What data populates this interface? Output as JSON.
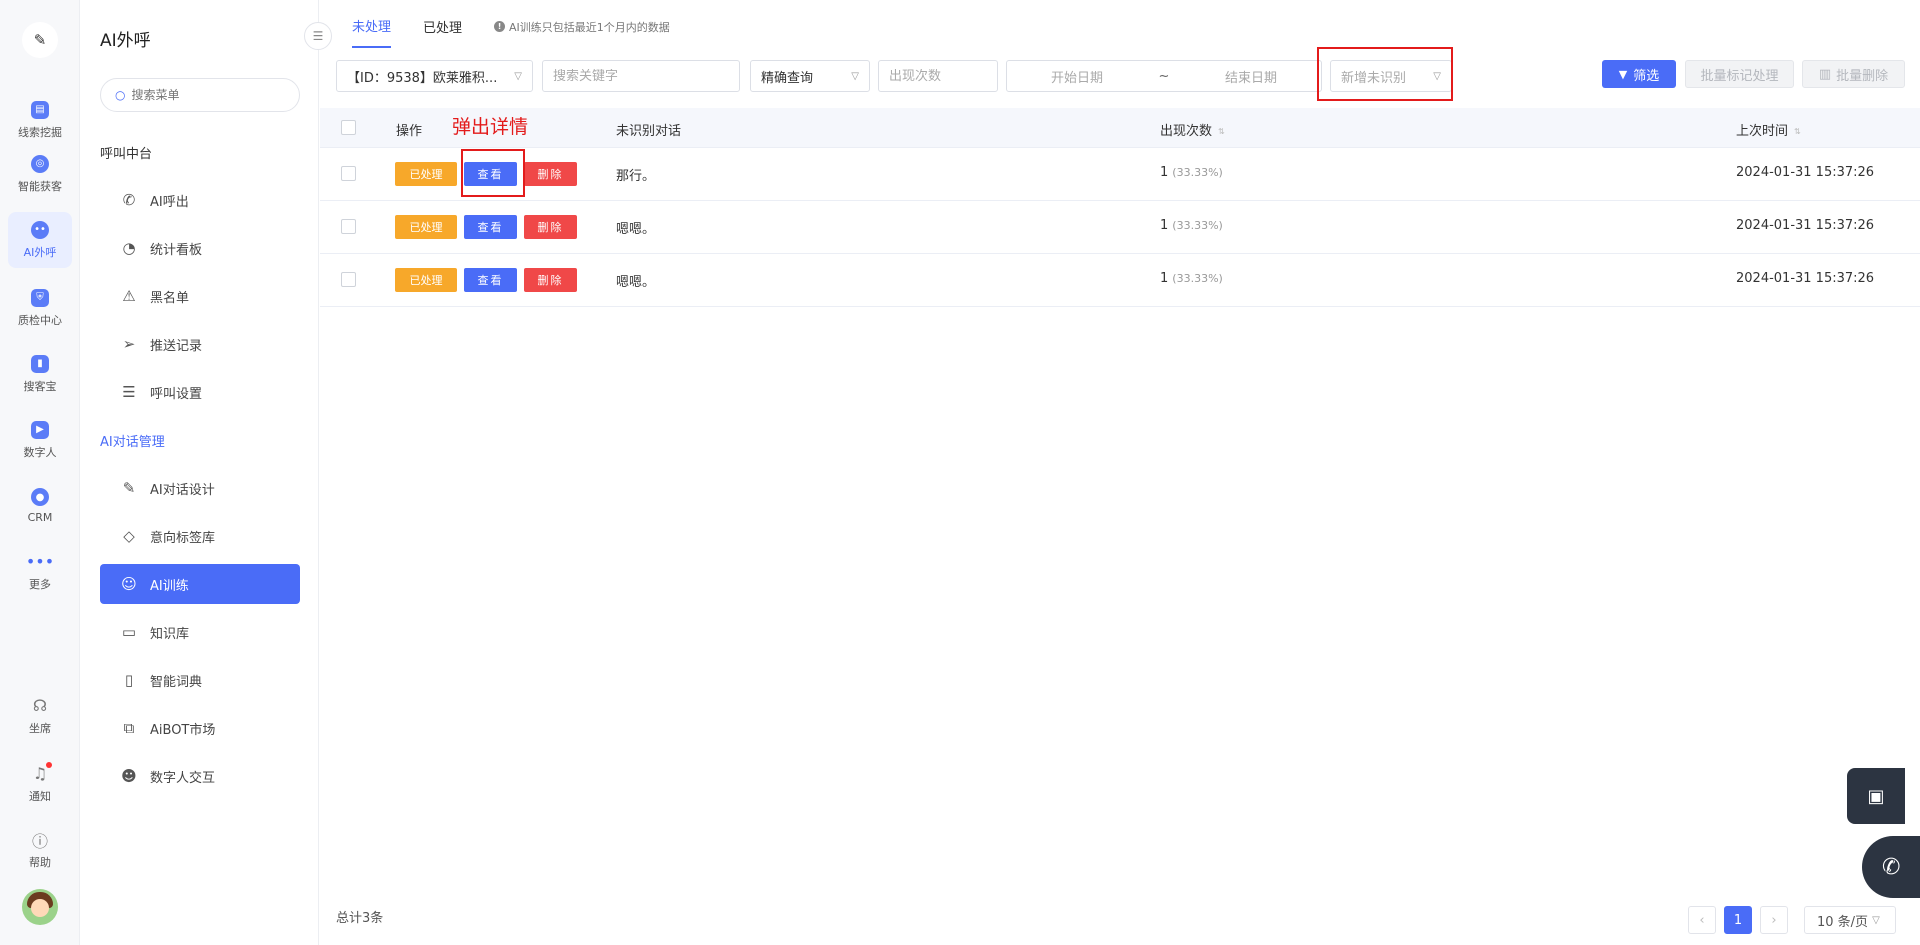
{
  "rail": {
    "items": [
      {
        "label": "线索挖掘",
        "icon": "document-icon"
      },
      {
        "label": "智能获客",
        "icon": "target-icon"
      },
      {
        "label": "AI外呼",
        "icon": "robot-icon"
      },
      {
        "label": "质检中心",
        "icon": "shield-icon"
      },
      {
        "label": "搜客宝",
        "icon": "search-card-icon"
      },
      {
        "label": "数字人",
        "icon": "video-icon"
      },
      {
        "label": "CRM",
        "icon": "crm-icon"
      },
      {
        "label": "更多",
        "icon": "more-icon"
      }
    ],
    "bottom": [
      {
        "label": "坐席",
        "icon": "headset-icon"
      },
      {
        "label": "通知",
        "icon": "bell-icon"
      },
      {
        "label": "帮助",
        "icon": "help-icon"
      }
    ]
  },
  "sidebar": {
    "title": "AI外呼",
    "search_placeholder": "搜索菜单",
    "group1": "呼叫中台",
    "group1_items": [
      "AI呼出",
      "统计看板",
      "黑名单",
      "推送记录",
      "呼叫设置"
    ],
    "group2": "AI对话管理",
    "group2_items": [
      "AI对话设计",
      "意向标签库",
      "AI训练",
      "知识库",
      "智能词典",
      "AiBOT市场",
      "数字人交互"
    ]
  },
  "tabs": {
    "pending": "未处理",
    "done": "已处理",
    "note": "AI训练只包括最近1个月内的数据"
  },
  "filters": {
    "bot_select": "【ID：9538】欧莱雅积...",
    "keyword_placeholder": "搜索关键字",
    "match_select": "精确查询",
    "count_placeholder": "出现次数",
    "start_date": "开始日期",
    "date_sep": "~",
    "end_date": "结束日期",
    "new_select": "新增未识别",
    "filter_button": "筛选",
    "batch_mark": "批量标记处理",
    "batch_delete": "批量删除"
  },
  "annotation": {
    "popup_label": "弹出详情"
  },
  "table": {
    "headers": {
      "action": "操作",
      "dialog": "未识别对话",
      "count": "出现次数",
      "last_time": "上次时间"
    },
    "btn_done": "已处理",
    "btn_view": "查看",
    "btn_delete": "删除",
    "rows": [
      {
        "dialog": "那行。",
        "count": "1",
        "pct": "(33.33%)",
        "time": "2024-01-31 15:37:26"
      },
      {
        "dialog": "嗯嗯。",
        "count": "1",
        "pct": "(33.33%)",
        "time": "2024-01-31 15:37:26"
      },
      {
        "dialog": "嗯嗯。",
        "count": "1",
        "pct": "(33.33%)",
        "time": "2024-01-31 15:37:26"
      }
    ]
  },
  "footer": {
    "total": "总计3条",
    "current_page": "1",
    "page_size": "10 条/页"
  },
  "colors": {
    "accent": "#4a6cf7",
    "done": "#f7a82a",
    "delete": "#f04848",
    "annotation": "#e31b1b"
  }
}
